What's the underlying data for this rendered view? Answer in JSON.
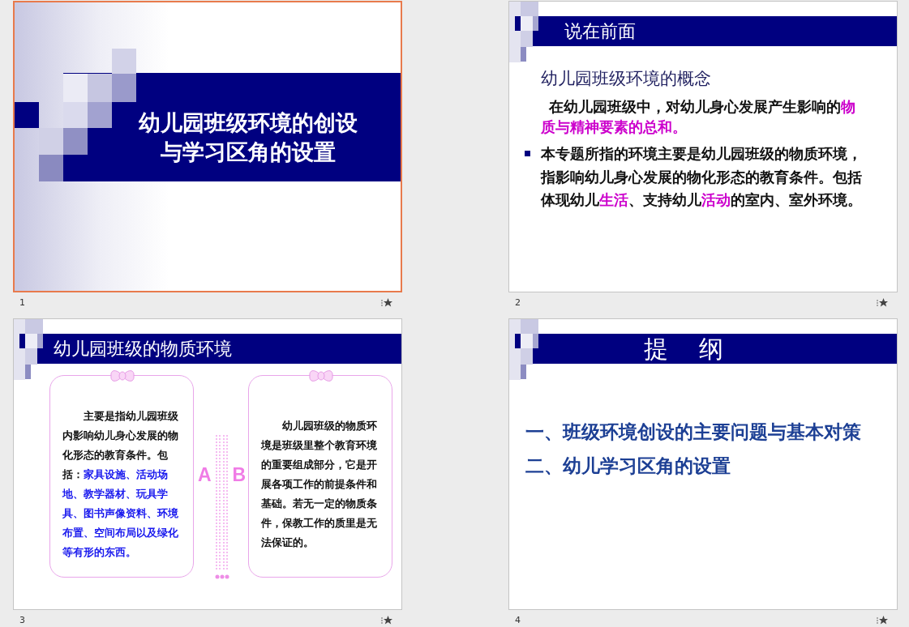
{
  "rows": [
    {
      "slides": [
        {
          "number": "1",
          "selected": true,
          "kind": "title",
          "title_lines": [
            "幼儿园班级环境的创设",
            "与学习区角的设置"
          ]
        },
        {
          "number": "2",
          "selected": false,
          "kind": "content",
          "heading": "说在前面",
          "subheading": "幼儿园班级环境的概念",
          "paragraphs": [
            {
              "kind": "plain",
              "segments": [
                {
                  "text": "在幼儿园班级中，对幼儿身心发展产生影响的",
                  "highlight": false
                },
                {
                  "text": "物质与精神要素的总和。",
                  "highlight": true
                }
              ]
            },
            {
              "kind": "bullet",
              "segments": [
                {
                  "text": "本专题所指的环境主要是幼儿园班级的物质环境，",
                  "highlight": false
                }
              ]
            },
            {
              "kind": "continuation",
              "segments": [
                {
                  "text": "指影响幼儿身心发展的物化形态的教育条件。包括体现幼儿",
                  "highlight": false
                },
                {
                  "text": "生活",
                  "highlight": true
                },
                {
                  "text": "、支持幼儿",
                  "highlight": false
                },
                {
                  "text": "活动",
                  "highlight": true
                },
                {
                  "text": "的室内、室外环境。",
                  "highlight": false
                }
              ]
            }
          ]
        }
      ]
    },
    {
      "slides": [
        {
          "number": "3",
          "selected": false,
          "kind": "comparison",
          "heading": "幼儿园班级的物质环境",
          "cards": [
            {
              "label": "A",
              "segments": [
                {
                  "text": "主要是指幼儿园班级内影响幼儿身心发展的物化形态的教育条件。包括：",
                  "highlight": false
                },
                {
                  "text": "家具设施、活动场地、教学器材、玩具学具、图书声像资料、环境布置、空间布局以及绿化等有形的东西。",
                  "highlight": true
                }
              ]
            },
            {
              "label": "B",
              "segments": [
                {
                  "text": "幼儿园班级的物质环境是班级里整个教育环境的重要组成部分，它是开展各项工作的前提条件和基础。若无一定的物质条件，保教工作的质里是无法保证的。",
                  "highlight": false
                }
              ]
            }
          ]
        },
        {
          "number": "4",
          "selected": false,
          "kind": "outline",
          "heading": "提　纲",
          "items": [
            "一、班级环境创设的主要问题与基本对策",
            "二、幼儿学习区角的设置"
          ]
        }
      ]
    }
  ]
}
